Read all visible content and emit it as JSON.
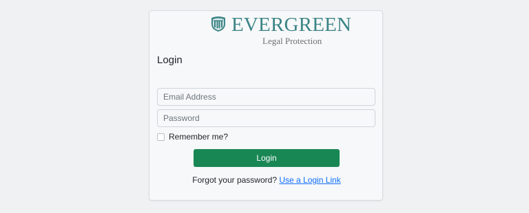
{
  "brand": {
    "icon": "shield-columns-icon",
    "name": "EVERGREEN",
    "tagline": "Legal Protection",
    "color": "#3c8486"
  },
  "form": {
    "title": "Login",
    "email_placeholder": "Email Address",
    "password_placeholder": "Password",
    "remember_label": "Remember me?",
    "remember_checked": false,
    "submit_label": "Login",
    "forgot_text": "Forgot your password?",
    "forgot_link_label": "Use a Login Link"
  },
  "colors": {
    "primary_button": "#198754",
    "link": "#0d6efd",
    "background": "#f0f1f3",
    "card": "#f7f8f9"
  }
}
